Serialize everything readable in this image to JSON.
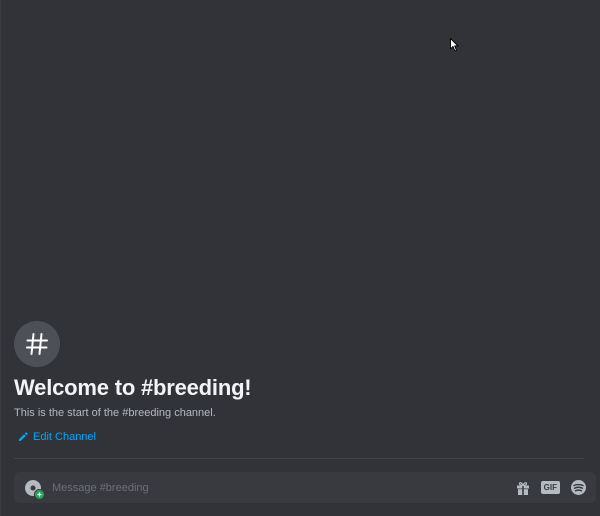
{
  "welcome": {
    "icon": "hash-icon",
    "title": "Welcome to #breeding!",
    "subtitle": "This is the start of the #breeding channel.",
    "edit_channel_label": "Edit Channel"
  },
  "composer": {
    "placeholder": "Message #breeding",
    "value": "",
    "gif_label": "GIF",
    "icons": [
      "add-attachment-icon",
      "gift-icon",
      "gif-icon",
      "sticker-icon"
    ]
  },
  "colors": {
    "background": "#313338",
    "composer": "#383a40",
    "link": "#00a8fc",
    "text_primary": "#f2f3f5",
    "text_muted": "#b5bac1"
  }
}
